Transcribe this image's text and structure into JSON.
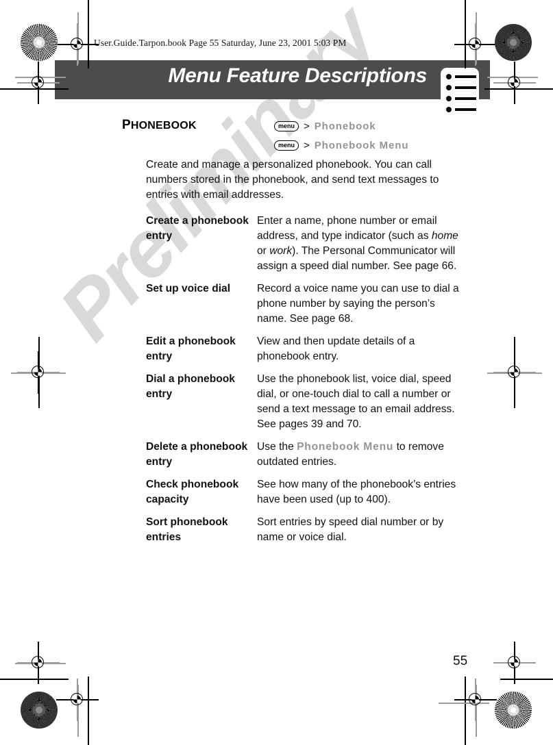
{
  "running_head": "User.Guide.Tarpon.book  Page 55  Saturday, June 23, 2001  5:03 PM",
  "watermark": "Preliminary",
  "banner": {
    "title": "Menu Feature Descriptions",
    "icon": "menu-list-icon",
    "background_color": "#4c4c4c",
    "text_color": "#ffffff"
  },
  "section": {
    "label_first_letter": "P",
    "label_rest": "HONEBOOK",
    "label_full": "PHONEBOOK",
    "nav_paths": [
      {
        "key": "menu",
        "separator": ">",
        "path": "Phonebook"
      },
      {
        "key": "menu",
        "separator": ">",
        "path": "Phonebook Menu"
      }
    ],
    "intro": "Create and manage a personalized phonebook. You can call numbers stored in the phonebook, and send text messages to entries with email addresses."
  },
  "features": [
    {
      "term": "Create a phonebook entry",
      "desc_parts": [
        {
          "text": "Enter a name, phone number or email address, and type indicator (such as ",
          "style": "normal"
        },
        {
          "text": "home",
          "style": "italic"
        },
        {
          "text": " or ",
          "style": "normal"
        },
        {
          "text": "work",
          "style": "italic"
        },
        {
          "text": "). The Personal Communicator will assign a speed dial number. See page 66.",
          "style": "normal"
        }
      ]
    },
    {
      "term": "Set up voice dial",
      "desc_parts": [
        {
          "text": "Record a voice name you can use to dial a phone number by saying the person’s name. See page 68.",
          "style": "normal"
        }
      ]
    },
    {
      "term": "Edit a phonebook entry",
      "desc_parts": [
        {
          "text": "View and then update details of a phonebook entry.",
          "style": "normal"
        }
      ]
    },
    {
      "term": "Dial a phonebook entry",
      "desc_parts": [
        {
          "text": "Use the phonebook list, voice dial, speed dial, or one-touch dial to call a number or send a text message to an email address. See pages 39 and 70.",
          "style": "normal"
        }
      ]
    },
    {
      "term": "Delete a phonebook entry",
      "desc_parts": [
        {
          "text": "Use the ",
          "style": "normal"
        },
        {
          "text": "Phonebook Menu",
          "style": "ui-grey"
        },
        {
          "text": " to remove outdated entries.",
          "style": "normal"
        }
      ]
    },
    {
      "term": "Check phonebook capacity",
      "desc_parts": [
        {
          "text": "See how many of the phonebook’s entries have been used (up to 400).",
          "style": "normal"
        }
      ]
    },
    {
      "term": "Sort phonebook entries",
      "desc_parts": [
        {
          "text": "Sort entries by speed dial number or by name or voice dial.",
          "style": "normal"
        }
      ]
    }
  ],
  "page_number": "55"
}
